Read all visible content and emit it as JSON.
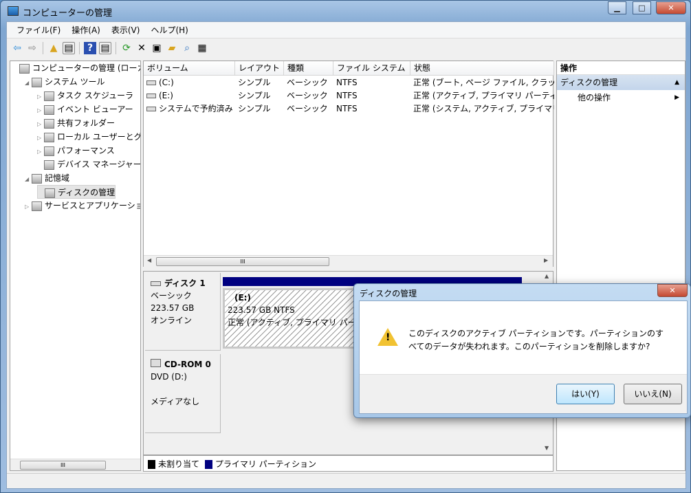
{
  "window": {
    "title": "コンピューターの管理",
    "minimize": "▁",
    "maximize": "□",
    "close": "✕"
  },
  "menu": [
    "ファイル(F)",
    "操作(A)",
    "表示(V)",
    "ヘルプ(H)"
  ],
  "tree": [
    {
      "label": "コンピューターの管理 (ローカル)",
      "level": 0,
      "expander": ""
    },
    {
      "label": "システム ツール",
      "level": 1,
      "expander": "◢"
    },
    {
      "label": "タスク スケジューラ",
      "level": 2,
      "expander": "▷"
    },
    {
      "label": "イベント ビューアー",
      "level": 2,
      "expander": "▷"
    },
    {
      "label": "共有フォルダー",
      "level": 2,
      "expander": "▷"
    },
    {
      "label": "ローカル ユーザーとグループ",
      "level": 2,
      "expander": "▷"
    },
    {
      "label": "パフォーマンス",
      "level": 2,
      "expander": "▷"
    },
    {
      "label": "デバイス マネージャー",
      "level": 2,
      "expander": ""
    },
    {
      "label": "記憶域",
      "level": 1,
      "expander": "◢"
    },
    {
      "label": "ディスクの管理",
      "level": 2,
      "expander": "",
      "selected": true
    },
    {
      "label": "サービスとアプリケーション",
      "level": 1,
      "expander": "▷"
    }
  ],
  "volumes": {
    "headers": [
      "ボリューム",
      "レイアウト",
      "種類",
      "ファイル システム",
      "状態"
    ],
    "rows": [
      [
        "(C:)",
        "シンプル",
        "ベーシック",
        "NTFS",
        "正常 (ブート, ページ ファイル, クラッシュ ダンプ"
      ],
      [
        "(E:)",
        "シンプル",
        "ベーシック",
        "NTFS",
        "正常 (アクティブ, プライマリ パーティション)"
      ],
      [
        "システムで予約済み",
        "シンプル",
        "ベーシック",
        "NTFS",
        "正常 (システム, アクティブ, プライマリ パーティション)"
      ]
    ]
  },
  "disks": [
    {
      "name": "ディスク 1",
      "type": "ベーシック",
      "size": "223.57 GB",
      "status": "オンライン",
      "partition": {
        "label": "(E:)",
        "size": "223.57 GB NTFS",
        "status": "正常 (アクティブ, プライマリ パーティション)"
      }
    },
    {
      "name": "CD-ROM 0",
      "type": "DVD (D:)",
      "size": "",
      "status": "メディアなし"
    }
  ],
  "legend": [
    {
      "label": "未割り当て",
      "color": "#000000"
    },
    {
      "label": "プライマリ パーティション",
      "color": "#000080"
    }
  ],
  "actions": {
    "header": "操作",
    "section": "ディスクの管理",
    "item": "他の操作"
  },
  "scroll_grip": "III",
  "dialog": {
    "title": "ディスクの管理",
    "message_line1": "このディスクのアクティブ パーティションです。パーティションのす",
    "message_line2": "べてのデータが失われます。このパーティションを削除しますか?",
    "yes": "はい(Y)",
    "no": "いいえ(N)",
    "close": "✕"
  }
}
